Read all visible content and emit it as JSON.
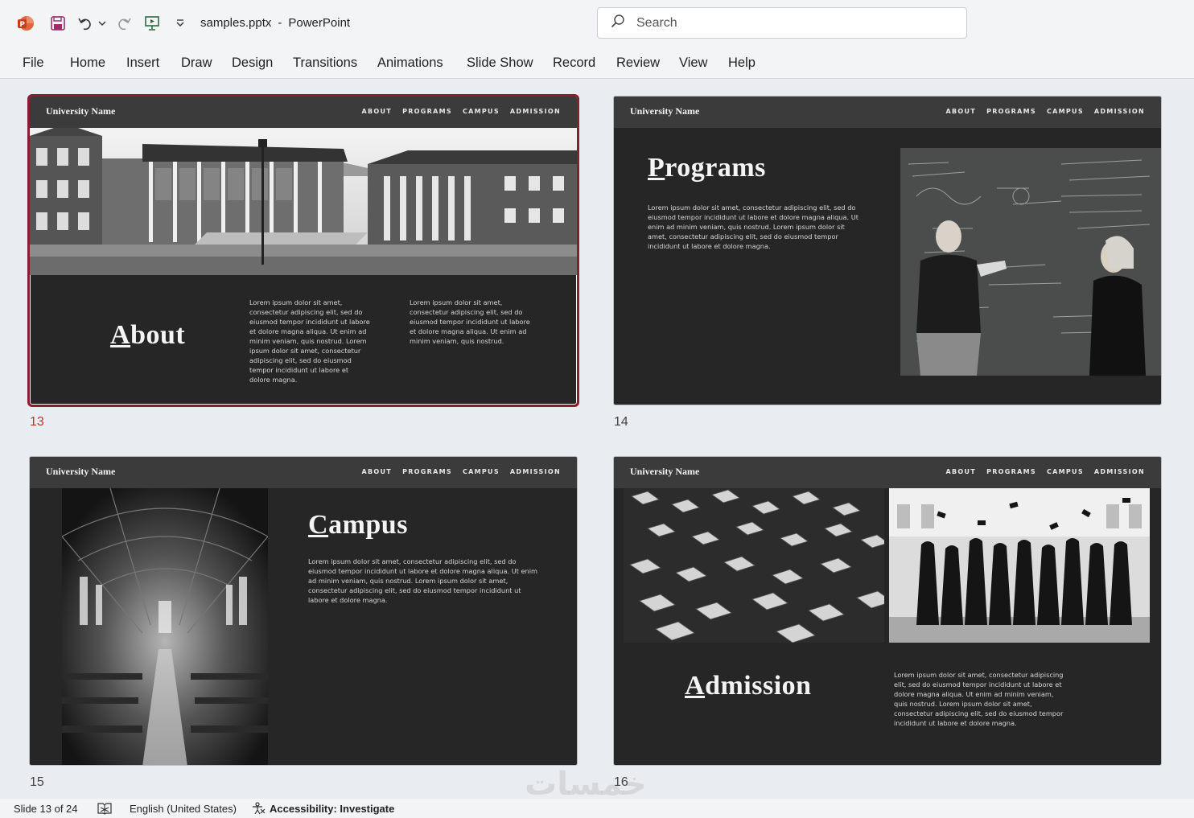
{
  "titlebar": {
    "file_name": "samples.pptx",
    "separator": "-",
    "app_name": "PowerPoint",
    "search_placeholder": "Search"
  },
  "ribbon": {
    "tabs": [
      "File",
      "Home",
      "Insert",
      "Draw",
      "Design",
      "Transitions",
      "Animations",
      "Slide Show",
      "Record",
      "Review",
      "View",
      "Help"
    ]
  },
  "slide_common": {
    "university_name": "University Name",
    "nav": [
      "ABOUT",
      "PROGRAMS",
      "CAMPUS",
      "ADMISSION"
    ]
  },
  "slides": [
    {
      "number": "13",
      "heading": "About",
      "body_col1": "Lorem ipsum dolor sit amet, consectetur adipiscing elit, sed do eiusmod tempor incididunt ut labore et dolore magna aliqua. Ut enim ad minim veniam, quis nostrud. Lorem ipsum dolor sit amet, consectetur adipiscing elit, sed do eiusmod tempor incididunt ut labore et dolore magna.",
      "body_col2": "Lorem ipsum dolor sit amet, consectetur adipiscing elit, sed do eiusmod tempor incididunt ut labore et dolore magna aliqua. Ut enim ad minim veniam, quis nostrud."
    },
    {
      "number": "14",
      "heading": "Programs",
      "body": "Lorem ipsum dolor sit amet, consectetur adipiscing elit, sed do eiusmod tempor incididunt ut labore et dolore magna aliqua. Ut enim ad minim veniam, quis nostrud. Lorem ipsum dolor sit amet, consectetur adipiscing elit, sed do eiusmod tempor incididunt ut labore et dolore magna."
    },
    {
      "number": "15",
      "heading": "Campus",
      "body": "Lorem ipsum dolor sit amet, consectetur adipiscing elit, sed do eiusmod tempor incididunt ut labore et dolore magna aliqua. Ut enim ad minim veniam, quis nostrud. Lorem ipsum dolor sit amet, consectetur adipiscing elit, sed do eiusmod tempor incididunt ut labore et dolore magna."
    },
    {
      "number": "16",
      "heading": "Admission",
      "body": "Lorem ipsum dolor sit amet, consectetur adipiscing elit, sed do eiusmod tempor incididunt ut labore et dolore magna aliqua. Ut enim ad minim veniam, quis nostrud. Lorem ipsum dolor sit amet, consectetur adipiscing elit, sed do eiusmod tempor incididunt ut labore et dolore magna."
    }
  ],
  "statusbar": {
    "slide_position": "Slide 13 of 24",
    "language": "English (United States)",
    "accessibility": "Accessibility: Investigate"
  },
  "watermark": "خمسات",
  "colors": {
    "selection": "#8e1c2c",
    "slide_bg": "#262626",
    "slide_header": "#3b3b3b",
    "app_accent": "#c43e1c"
  }
}
